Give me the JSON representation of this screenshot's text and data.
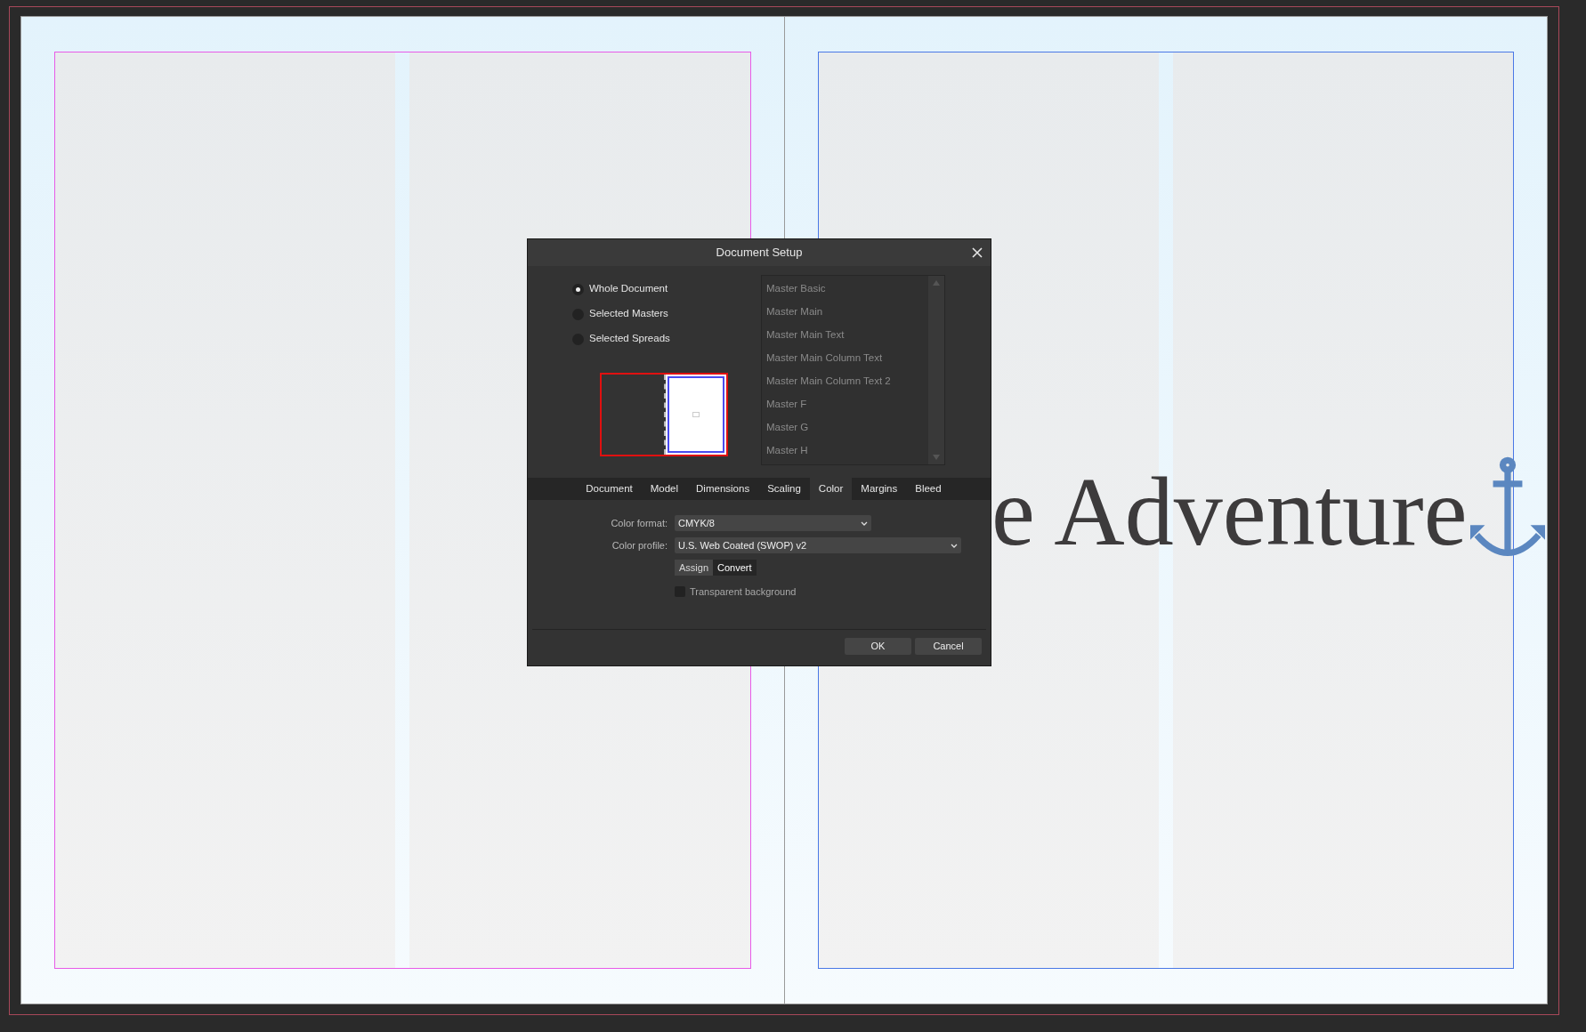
{
  "canvas": {
    "headline": "e Adventure"
  },
  "dialog": {
    "title": "Document Setup",
    "scope_options": [
      {
        "label": "Whole Document",
        "selected": true
      },
      {
        "label": "Selected Masters",
        "selected": false
      },
      {
        "label": "Selected Spreads",
        "selected": false
      }
    ],
    "masters": [
      "Master Basic",
      "Master Main",
      "Master Main Text",
      "Master Main Column Text",
      "Master Main Column Text 2",
      "Master F",
      "Master G",
      "Master H"
    ],
    "tabs": [
      {
        "label": "Document",
        "selected": false
      },
      {
        "label": "Model",
        "selected": false
      },
      {
        "label": "Dimensions",
        "selected": false
      },
      {
        "label": "Scaling",
        "selected": false
      },
      {
        "label": "Color",
        "selected": true
      },
      {
        "label": "Margins",
        "selected": false
      },
      {
        "label": "Bleed",
        "selected": false
      }
    ],
    "color_format": {
      "label": "Color format:",
      "value": "CMYK/8"
    },
    "color_profile": {
      "label": "Color profile:",
      "value": "U.S. Web Coated (SWOP) v2"
    },
    "profile_modes": [
      {
        "label": "Assign",
        "selected": false
      },
      {
        "label": "Convert",
        "selected": true
      }
    ],
    "transparent_background": {
      "label": "Transparent background",
      "checked": false
    },
    "buttons": [
      "OK",
      "Cancel"
    ]
  }
}
